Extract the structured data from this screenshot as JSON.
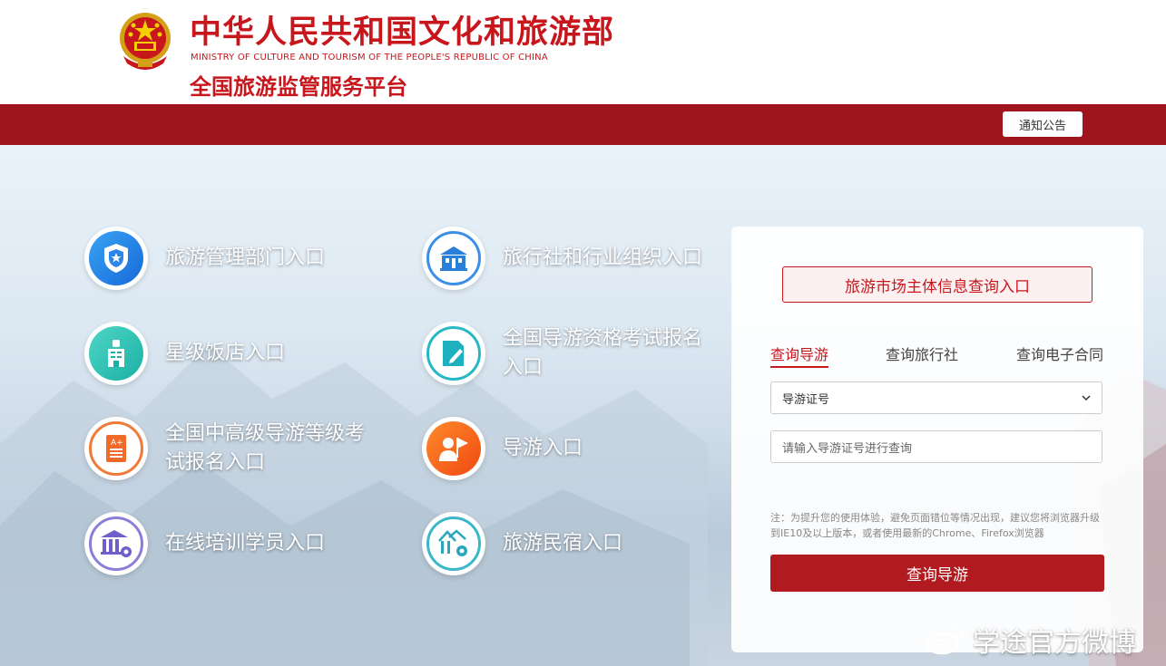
{
  "header": {
    "title_cn": "中华人民共和国文化和旅游部",
    "title_en": "MINISTRY OF CULTURE AND TOURISM OF THE PEOPLE'S REPUBLIC OF CHINA",
    "subtitle": "全国旅游监管服务平台"
  },
  "nav": {
    "notice_label": "通知公告"
  },
  "entries": [
    {
      "label": "旅游管理部门入口",
      "icon": "shield-star-icon"
    },
    {
      "label": "旅行社和行业组织入口",
      "icon": "building-icon"
    },
    {
      "label": "星级饭店入口",
      "icon": "hotel-icon"
    },
    {
      "label": "全国导游资格考试报名入口",
      "icon": "document-pen-icon"
    },
    {
      "label": "全国中高级导游等级考试报名入口",
      "icon": "certificate-icon"
    },
    {
      "label": "导游入口",
      "icon": "guide-flag-icon"
    },
    {
      "label": "在线培训学员入口",
      "icon": "institution-gear-icon"
    },
    {
      "label": "旅游民宿入口",
      "icon": "homestay-gear-icon"
    }
  ],
  "panel": {
    "title": "旅游市场主体信息查询入口",
    "tabs": [
      "查询导游",
      "查询旅行社",
      "查询电子合同"
    ],
    "active_tab": "查询导游",
    "select_value": "导游证号",
    "input_placeholder": "请输入导游证号进行查询",
    "note": "注：为提升您的使用体验，避免页面错位等情况出现，建议您将浏览器升级到IE10及以上版本，或者使用最新的Chrome、Firefox浏览器",
    "button_label": "查询导游"
  },
  "watermark": {
    "text": "学途官方微博"
  },
  "colors": {
    "brand_red": "#a0151b",
    "accent_red": "#c8161d"
  }
}
